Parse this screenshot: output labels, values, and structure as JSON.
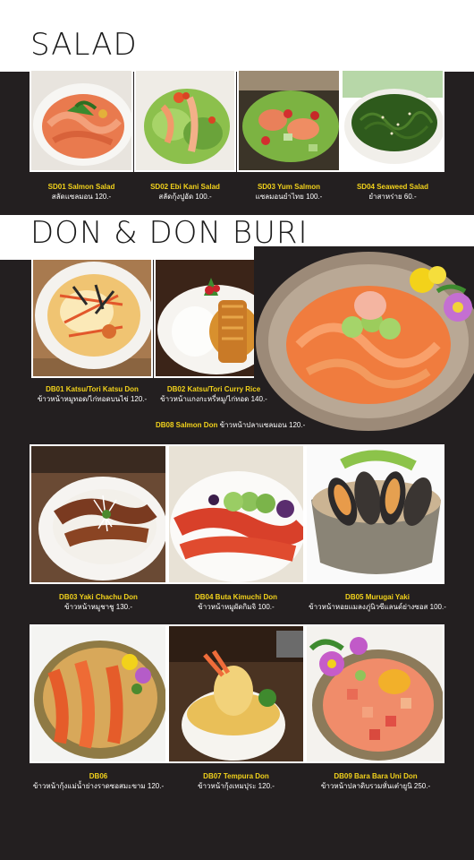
{
  "sections": {
    "salad_title": "SALAD",
    "don_title": "DON & DON BURI"
  },
  "salad": [
    {
      "code": "SD01 Salmon Salad",
      "thai": "สลัดแซลมอน 120.-"
    },
    {
      "code": "SD02 Ebi Kani Salad",
      "thai": "สลัดกุ้งปูอัด 100.-"
    },
    {
      "code": "SD03 Yum Salmon",
      "thai": "แซลมอนยำไทย 100.-"
    },
    {
      "code": "SD04 Seaweed Salad",
      "thai": "ยำสาหร่าย 60.-"
    }
  ],
  "don": {
    "db01": {
      "code": "DB01 Katsu/Tori Katsu Don",
      "thai": "ข้าวหน้าหมูทอด/ไก่ทอดบนไข่ 120.-"
    },
    "db02": {
      "code": "DB02 Katsu/Tori Curry Rice",
      "thai": "ข้าวหน้าแกงกะหรี่หมู/ไก่ทอด 140.-"
    },
    "db08": {
      "code": "DB08 Salmon Don",
      "thai": "ข้าวหน้าปลาแซลมอน 120.-"
    },
    "db03": {
      "code": "DB03 Yaki Chachu Don",
      "thai": "ข้าวหน้าหมูชาชู 130.-"
    },
    "db04": {
      "code": "DB04 Buta Kimuchi Don",
      "thai": "ข้าวหน้าหมูผัดกิมจิ 100.-"
    },
    "db05": {
      "code": "DB05 Murugai Yaki",
      "thai": "ข้าวหน้าหอยแมลงภู่นิวซีแลนด์ย่างซอส 100.-"
    },
    "db06": {
      "code": "DB06",
      "thai": "ข้าวหน้ากุ้งแม่น้ำย่างราดซอสมะขาม 120.-"
    },
    "db07": {
      "code": "DB07 Tempura Don",
      "thai": "ข้าวหน้ากุ้งเทมปุระ 120.-"
    },
    "db09": {
      "code": "DB09 Bara Bara Uni Don",
      "thai": "ข้าวหน้าปลาดิบรวมหั่นเต๋ายูนิ 250.-"
    }
  },
  "colors": {
    "background": "#231f20",
    "band": "#ffffff",
    "code_text": "#f2d21b",
    "thai_text": "#ffffff"
  }
}
